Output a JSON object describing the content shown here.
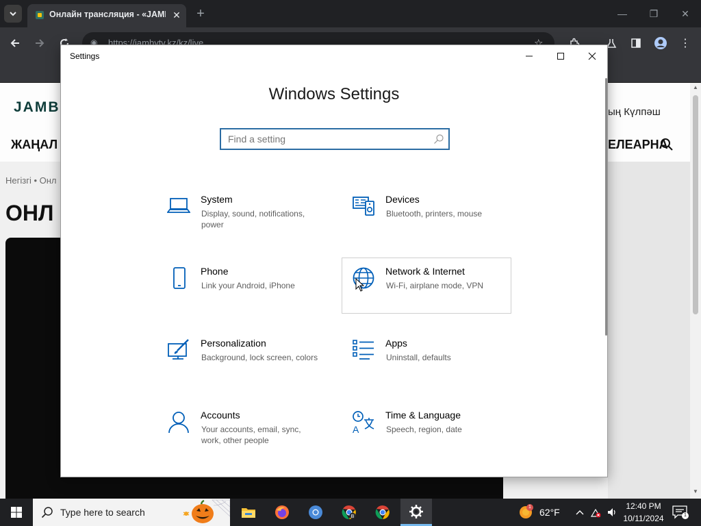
{
  "browser": {
    "tab_title": "Онлайн трансляция - «JAMBY",
    "url": "https://jambytv.kz/kz/live"
  },
  "webpage": {
    "logo": "JAMBY",
    "header_right": "ың Күлпәш",
    "nav_left": "ЖАҢАЛ",
    "nav_right": "ЕЛЕАРНА",
    "breadcrumb": "Негізгі  •  Онл",
    "heading": "ОНЛ"
  },
  "settings": {
    "window_title": "Settings",
    "heading": "Windows Settings",
    "search_placeholder": "Find a setting",
    "tiles": [
      {
        "title": "System",
        "desc": "Display, sound, notifications, power",
        "icon": "laptop-icon"
      },
      {
        "title": "Devices",
        "desc": "Bluetooth, printers, mouse",
        "icon": "devices-icon"
      },
      {
        "title": "Phone",
        "desc": "Link your Android, iPhone",
        "icon": "phone-icon"
      },
      {
        "title": "Network & Internet",
        "desc": "Wi-Fi, airplane mode, VPN",
        "icon": "globe-icon",
        "hovered": true
      },
      {
        "title": "Personalization",
        "desc": "Background, lock screen, colors",
        "icon": "paintbrush-icon"
      },
      {
        "title": "Apps",
        "desc": "Uninstall, defaults",
        "icon": "apps-list-icon"
      },
      {
        "title": "Accounts",
        "desc": "Your accounts, email, sync, work, other people",
        "icon": "person-icon"
      },
      {
        "title": "Time & Language",
        "desc": "Speech, region, date",
        "icon": "time-language-icon"
      }
    ]
  },
  "taskbar": {
    "search_text": "Type here to search",
    "weather_temp": "62°F",
    "weather_badge": "1",
    "time": "12:40 PM",
    "date": "10/11/2024",
    "notification_count": "1",
    "accent_color": "#76b9ed"
  },
  "colors": {
    "settings_accent": "#005fb8",
    "search_border": "#2b6ca3"
  }
}
